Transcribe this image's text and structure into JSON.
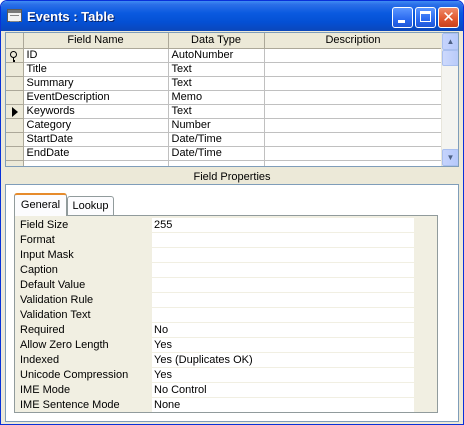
{
  "window": {
    "title": "Events : Table"
  },
  "icons": {
    "app": "table-icon",
    "minimize": "minimize-icon",
    "maximize": "maximize-icon",
    "close": "close-icon",
    "primary_key": "primary-key-icon",
    "current_row": "current-row-arrow-icon"
  },
  "grid": {
    "headers": [
      "Field Name",
      "Data Type",
      "Description"
    ],
    "rows": [
      {
        "name": "ID",
        "type": "AutoNumber",
        "description": "",
        "marker": "key"
      },
      {
        "name": "Title",
        "type": "Text",
        "description": "",
        "marker": ""
      },
      {
        "name": "Summary",
        "type": "Text",
        "description": "",
        "marker": ""
      },
      {
        "name": "EventDescription",
        "type": "Memo",
        "description": "",
        "marker": ""
      },
      {
        "name": "Keywords",
        "type": "Text",
        "description": "",
        "marker": "current"
      },
      {
        "name": "Category",
        "type": "Number",
        "description": "",
        "marker": ""
      },
      {
        "name": "StartDate",
        "type": "Date/Time",
        "description": "",
        "marker": ""
      },
      {
        "name": "EndDate",
        "type": "Date/Time",
        "description": "",
        "marker": ""
      },
      {
        "name": "",
        "type": "",
        "description": "",
        "marker": ""
      }
    ]
  },
  "field_properties": {
    "label": "Field Properties",
    "tabs": [
      "General",
      "Lookup"
    ],
    "active_tab": "General",
    "properties": [
      {
        "label": "Field Size",
        "value": "255"
      },
      {
        "label": "Format",
        "value": ""
      },
      {
        "label": "Input Mask",
        "value": ""
      },
      {
        "label": "Caption",
        "value": ""
      },
      {
        "label": "Default Value",
        "value": ""
      },
      {
        "label": "Validation Rule",
        "value": ""
      },
      {
        "label": "Validation Text",
        "value": ""
      },
      {
        "label": "Required",
        "value": "No"
      },
      {
        "label": "Allow Zero Length",
        "value": "Yes"
      },
      {
        "label": "Indexed",
        "value": "Yes (Duplicates OK)"
      },
      {
        "label": "Unicode Compression",
        "value": "Yes"
      },
      {
        "label": "IME Mode",
        "value": "No Control"
      },
      {
        "label": "IME Sentence Mode",
        "value": "None"
      }
    ]
  }
}
